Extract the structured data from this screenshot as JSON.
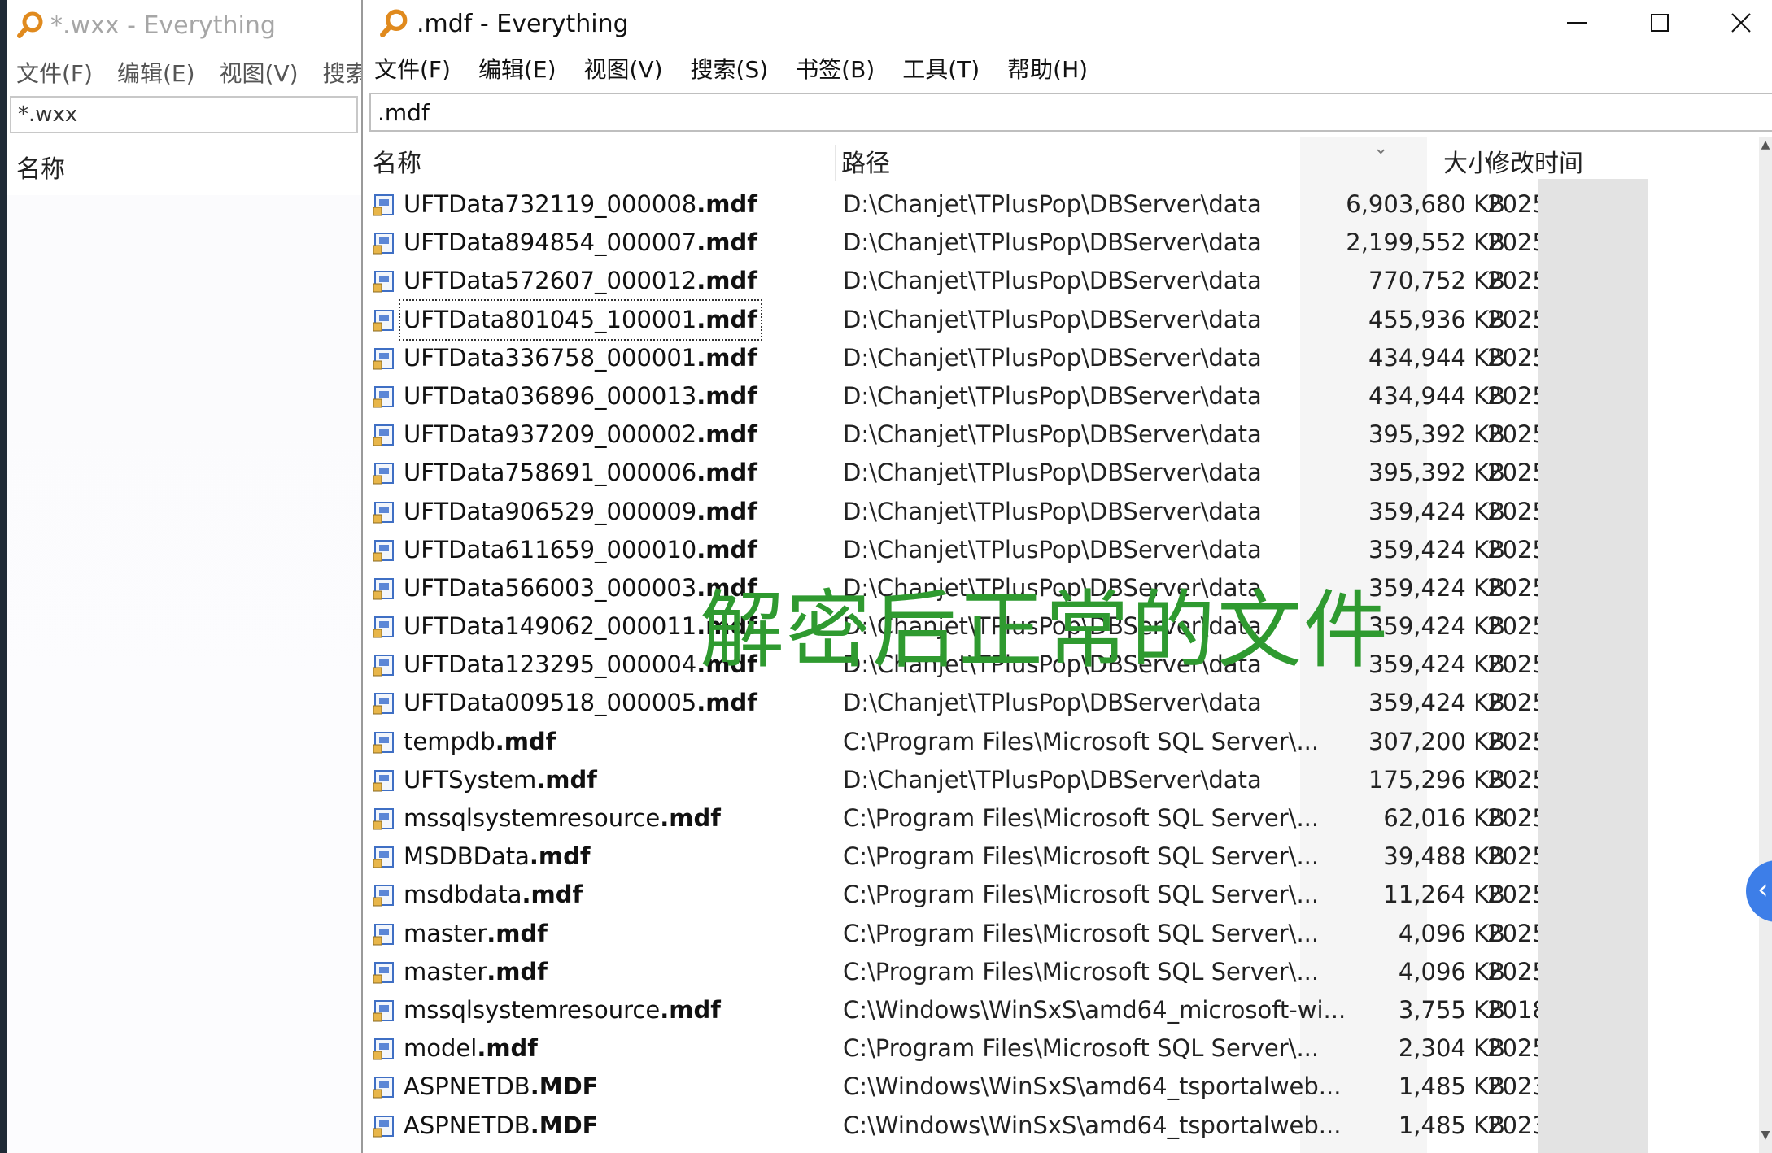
{
  "back_window": {
    "title": "*.wxx - Everything",
    "menu": [
      "文件(F)",
      "编辑(E)",
      "视图(V)",
      "搜索("
    ],
    "search_value": "*.wxx",
    "column_name": "名称"
  },
  "front_window": {
    "title": ".mdf - Everything",
    "menu": [
      "文件(F)",
      "编辑(E)",
      "视图(V)",
      "搜索(S)",
      "书签(B)",
      "工具(T)",
      "帮助(H)"
    ],
    "search_value": ".mdf",
    "columns": {
      "name": "名称",
      "path": "路径",
      "size": "大小",
      "date": "修改时间"
    },
    "sort_indicator": "⌄",
    "rows": [
      {
        "stem": "UFTData732119_000008",
        "ext": ".mdf",
        "path": "D:\\Chanjet\\TPlusPop\\DBServer\\data",
        "size": "6,903,680 KB",
        "date": "2025"
      },
      {
        "stem": "UFTData894854_000007",
        "ext": ".mdf",
        "path": "D:\\Chanjet\\TPlusPop\\DBServer\\data",
        "size": "2,199,552 KB",
        "date": "2025"
      },
      {
        "stem": "UFTData572607_000012",
        "ext": ".mdf",
        "path": "D:\\Chanjet\\TPlusPop\\DBServer\\data",
        "size": "770,752 KB",
        "date": "2025"
      },
      {
        "stem": "UFTData801045_100001",
        "ext": ".mdf",
        "path": "D:\\Chanjet\\TPlusPop\\DBServer\\data",
        "size": "455,936 KB",
        "date": "2025",
        "focused": true
      },
      {
        "stem": "UFTData336758_000001",
        "ext": ".mdf",
        "path": "D:\\Chanjet\\TPlusPop\\DBServer\\data",
        "size": "434,944 KB",
        "date": "2025"
      },
      {
        "stem": "UFTData036896_000013",
        "ext": ".mdf",
        "path": "D:\\Chanjet\\TPlusPop\\DBServer\\data",
        "size": "434,944 KB",
        "date": "2025"
      },
      {
        "stem": "UFTData937209_000002",
        "ext": ".mdf",
        "path": "D:\\Chanjet\\TPlusPop\\DBServer\\data",
        "size": "395,392 KB",
        "date": "2025"
      },
      {
        "stem": "UFTData758691_000006",
        "ext": ".mdf",
        "path": "D:\\Chanjet\\TPlusPop\\DBServer\\data",
        "size": "395,392 KB",
        "date": "2025"
      },
      {
        "stem": "UFTData906529_000009",
        "ext": ".mdf",
        "path": "D:\\Chanjet\\TPlusPop\\DBServer\\data",
        "size": "359,424 KB",
        "date": "2025"
      },
      {
        "stem": "UFTData611659_000010",
        "ext": ".mdf",
        "path": "D:\\Chanjet\\TPlusPop\\DBServer\\data",
        "size": "359,424 KB",
        "date": "2025"
      },
      {
        "stem": "UFTData566003_000003",
        "ext": ".mdf",
        "path": "D:\\Chanjet\\TPlusPop\\DBServer\\data",
        "size": "359,424 KB",
        "date": "2025"
      },
      {
        "stem": "UFTData149062_000011",
        "ext": ".mdf",
        "path": "D:\\Chanjet\\TPlusPop\\DBServer\\data",
        "size": "359,424 KB",
        "date": "2025"
      },
      {
        "stem": "UFTData123295_000004",
        "ext": ".mdf",
        "path": "D:\\Chanjet\\TPlusPop\\DBServer\\data",
        "size": "359,424 KB",
        "date": "2025"
      },
      {
        "stem": "UFTData009518_000005",
        "ext": ".mdf",
        "path": "D:\\Chanjet\\TPlusPop\\DBServer\\data",
        "size": "359,424 KB",
        "date": "2025"
      },
      {
        "stem": "tempdb",
        "ext": ".mdf",
        "path": "C:\\Program Files\\Microsoft SQL Server\\...",
        "size": "307,200 KB",
        "date": "2025"
      },
      {
        "stem": "UFTSystem",
        "ext": ".mdf",
        "path": "D:\\Chanjet\\TPlusPop\\DBServer\\data",
        "size": "175,296 KB",
        "date": "2025"
      },
      {
        "stem": "mssqlsystemresource",
        "ext": ".mdf",
        "path": "C:\\Program Files\\Microsoft SQL Server\\...",
        "size": "62,016 KB",
        "date": "2025"
      },
      {
        "stem": "MSDBData",
        "ext": ".mdf",
        "path": "C:\\Program Files\\Microsoft SQL Server\\...",
        "size": "39,488 KB",
        "date": "2025"
      },
      {
        "stem": "msdbdata",
        "ext": ".mdf",
        "path": "C:\\Program Files\\Microsoft SQL Server\\...",
        "size": "11,264 KB",
        "date": "2025"
      },
      {
        "stem": "master",
        "ext": ".mdf",
        "path": "C:\\Program Files\\Microsoft SQL Server\\...",
        "size": "4,096 KB",
        "date": "2025"
      },
      {
        "stem": "master",
        "ext": ".mdf",
        "path": "C:\\Program Files\\Microsoft SQL Server\\...",
        "size": "4,096 KB",
        "date": "2025"
      },
      {
        "stem": "mssqlsystemresource",
        "ext": ".mdf",
        "path": "C:\\Windows\\WinSxS\\amd64_microsoft-wi...",
        "size": "3,755 KB",
        "date": "2018"
      },
      {
        "stem": "model",
        "ext": ".mdf",
        "path": "C:\\Program Files\\Microsoft SQL Server\\...",
        "size": "2,304 KB",
        "date": "2025"
      },
      {
        "stem": "ASPNETDB",
        "ext": ".MDF",
        "path": "C:\\Windows\\WinSxS\\amd64_tsportalweb...",
        "size": "1,485 KB",
        "date": "2023"
      },
      {
        "stem": "ASPNETDB",
        "ext": ".MDF",
        "path": "C:\\Windows\\WinSxS\\amd64_tsportalweb...",
        "size": "1,485 KB",
        "date": "2023"
      }
    ]
  },
  "overlay_caption": "解密后正常的文件",
  "colors": {
    "overlay_green": "#2f9a30",
    "app_icon_orange": "#e08a1e",
    "file_icon_blue": "#3f6fc4"
  },
  "icons": {
    "app": "magnifier-app-icon",
    "file": "database-file-icon"
  }
}
